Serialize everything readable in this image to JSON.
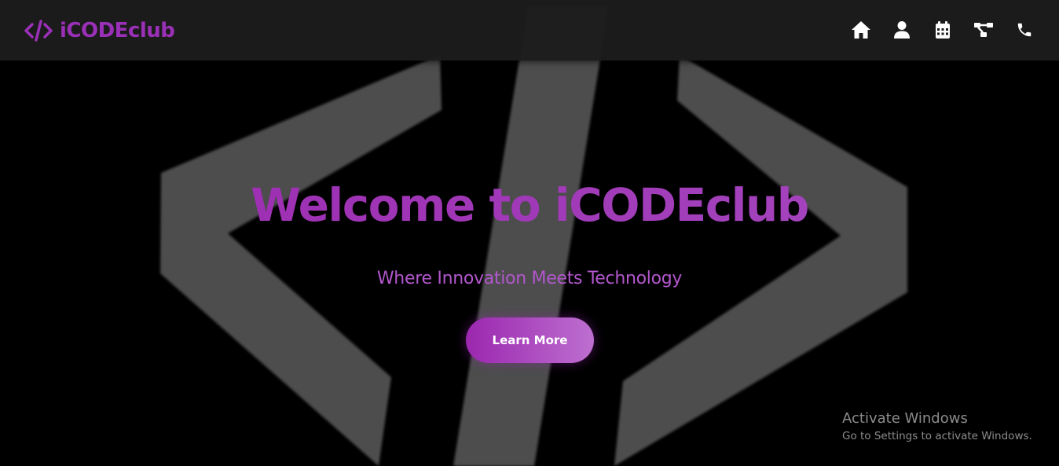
{
  "brand": {
    "name": "iCODEclub",
    "logo_icon": "code-icon",
    "color": "#9b30b8"
  },
  "nav": {
    "items": [
      {
        "icon": "home-icon"
      },
      {
        "icon": "user-icon"
      },
      {
        "icon": "calendar-icon"
      },
      {
        "icon": "network-icon"
      },
      {
        "icon": "phone-icon"
      }
    ]
  },
  "hero": {
    "title": "Welcome to iCODEclub",
    "subtitle": "Where Innovation Meets Technology",
    "cta_label": "Learn More",
    "accent_color": "#a137b8",
    "background_art": "code-brackets-icon"
  },
  "watermark": {
    "title": "Activate Windows",
    "subtitle": "Go to Settings to activate Windows."
  }
}
